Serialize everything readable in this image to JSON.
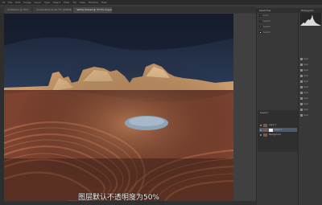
{
  "menubar": {
    "items": [
      "Ps",
      "File",
      "Edit",
      "Image",
      "Layer",
      "Type",
      "Select",
      "Filter",
      "3D",
      "View",
      "Window",
      "Help"
    ]
  },
  "tabs": [
    {
      "label": "Untitled-1 @ 50%"
    },
    {
      "label": "Screenshot @ 66.7% (RGB/8)"
    },
    {
      "label": "White Pocket @ 33.3% (Layer 1, RGB/8)",
      "active": true
    }
  ],
  "swatches_panel": {
    "tabs": [
      "Swatches"
    ],
    "rows": [
      "Color",
      "Swatch",
      "Swatch",
      "Swatch"
    ]
  },
  "histogram_panel": {
    "tab": "Histogram"
  },
  "layers_panel": {
    "tab": "Layers",
    "layers": [
      {
        "name": "Layer 1",
        "selected": false
      },
      {
        "name": "Layer 1",
        "selected": true,
        "mask": true
      },
      {
        "name": "Background",
        "selected": false
      }
    ]
  },
  "right_list": [
    "Layer",
    "Layer",
    "Layer",
    "Layer",
    "Layer",
    "Layer",
    "Layer",
    "Layer",
    "Layer",
    "Layer",
    "Layer"
  ],
  "subtitle": "图层默认不透明度为50%",
  "colors": {
    "sky": "#2b3a55",
    "rock": "#b0603a",
    "pool": "#8fa3b8"
  }
}
